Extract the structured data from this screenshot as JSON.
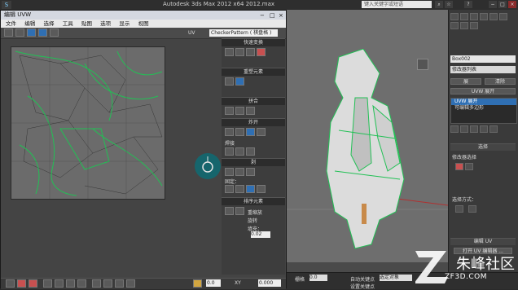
{
  "app": {
    "title": "Autodesk 3ds Max  2012 x64      2012.max",
    "logo": "S",
    "help_search_placeholder": "键入关键字或短语"
  },
  "uvw_editor": {
    "title": "编辑 UVW",
    "menu": [
      "文件",
      "编辑",
      "选择",
      "工具",
      "贴图",
      "选项",
      "显示",
      "视图"
    ],
    "uv_label": "UV",
    "pattern_dropdown": "CheckerPattern ( 棋盘格 )",
    "sections": {
      "quick_transform": "快速变换",
      "reshape": "重塑元素",
      "stitch": "拼合",
      "explode": "炸开",
      "weld": "焊接",
      "peel": "剥",
      "pin": "固定：",
      "arrange": "排序元素",
      "rescale": "重缩放",
      "rotate": "旋转",
      "padding": "填充："
    },
    "padding_value": "0.02",
    "zoom_value": "0.0",
    "xy_label": "XY",
    "coord_value": "0.000"
  },
  "command_panel": {
    "object_name": "Box002",
    "modifier_list": "修改器列表",
    "buttons": [
      "展",
      "清除"
    ],
    "uv_unwrap_btn": "UVW 展开",
    "stack": [
      "UVW 展开",
      "可编辑多边形"
    ],
    "selection_head": "选择",
    "modifier_selection": "修改器选择",
    "selection_mode": "选择方式：",
    "edit_uv_head": "编辑 UV",
    "open_editor_btn": "打开 UV 编辑器 ..."
  },
  "status": {
    "grid_label": "栅格",
    "grid_value": "0.0",
    "auto_key": "自动关键点",
    "selected": "选定对象",
    "set_key": "设置关键点"
  },
  "watermark": {
    "text": "朱峰社区",
    "url": "ZF3D.COM"
  }
}
